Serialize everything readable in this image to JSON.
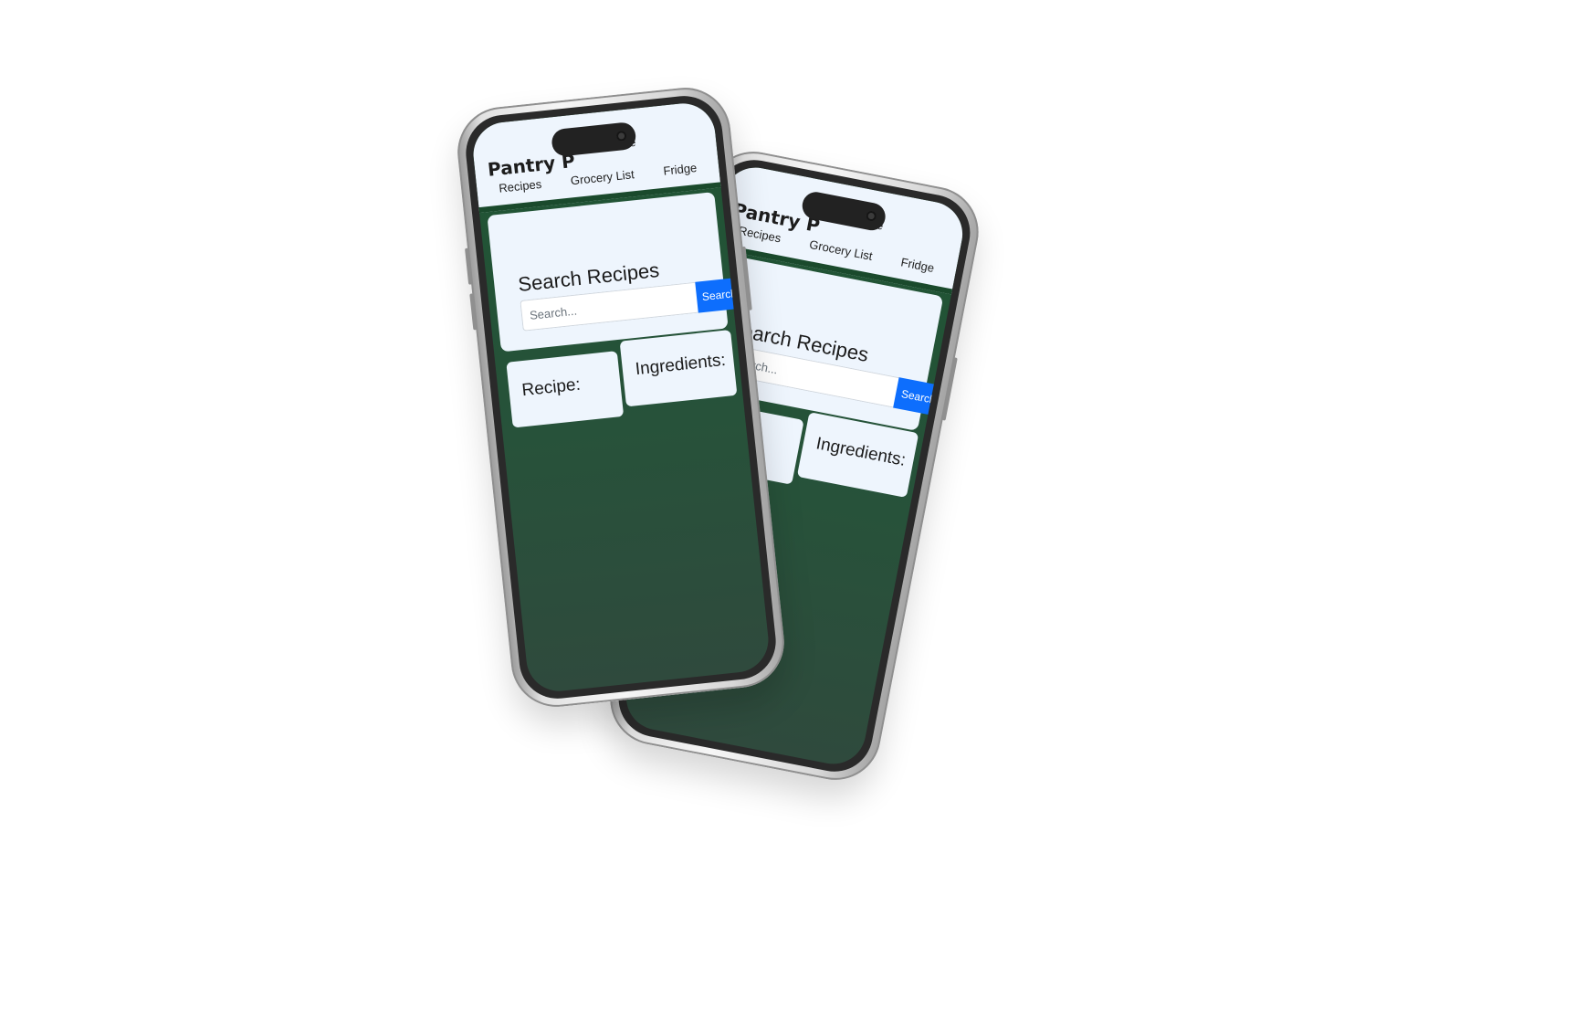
{
  "app": {
    "brand": "Pantry P",
    "nav_home_partial": "ne",
    "nav": [
      "Recipes",
      "Grocery List",
      "Fridge"
    ]
  },
  "search": {
    "title": "Search Recipes",
    "placeholder": "Search...",
    "button_label": "Search"
  },
  "cards": {
    "recipe_label": "Recipe:",
    "ingredients_label": "Ingredients:"
  },
  "colors": {
    "background": "#ffffff",
    "screen_green": "#1f5433",
    "header_bg": "#eef5fd",
    "card_bg": "#eef5fd",
    "accent_blue": "#0d6efd"
  }
}
